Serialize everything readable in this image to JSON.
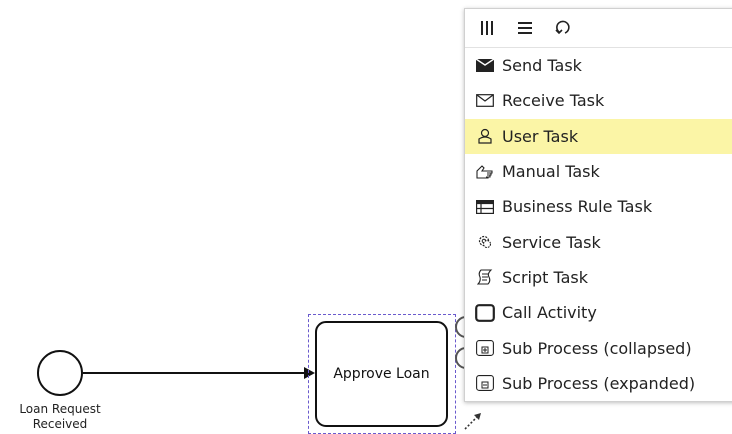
{
  "diagram": {
    "start_event": {
      "label_line1": "Loan Request",
      "label_line2": "Received"
    },
    "task": {
      "label": "Approve Loan"
    }
  },
  "popup_menu": {
    "header_icons": [
      "parallel-multi-instance-icon",
      "sequential-multi-instance-icon",
      "loop-icon"
    ],
    "entries": [
      {
        "label": "Send Task",
        "icon": "send-task-icon",
        "active": false
      },
      {
        "label": "Receive Task",
        "icon": "receive-task-icon",
        "active": false
      },
      {
        "label": "User Task",
        "icon": "user-task-icon",
        "active": true
      },
      {
        "label": "Manual Task",
        "icon": "manual-task-icon",
        "active": false
      },
      {
        "label": "Business Rule Task",
        "icon": "business-rule-task-icon",
        "active": false
      },
      {
        "label": "Service Task",
        "icon": "service-task-icon",
        "active": false
      },
      {
        "label": "Script Task",
        "icon": "script-task-icon",
        "active": false
      },
      {
        "label": "Call Activity",
        "icon": "call-activity-icon",
        "active": false
      },
      {
        "label": "Sub Process (collapsed)",
        "icon": "sub-process-collapsed-icon",
        "active": false
      },
      {
        "label": "Sub Process (expanded)",
        "icon": "sub-process-expanded-icon",
        "active": false
      }
    ],
    "active_highlight_color": "#fbf5a6"
  }
}
